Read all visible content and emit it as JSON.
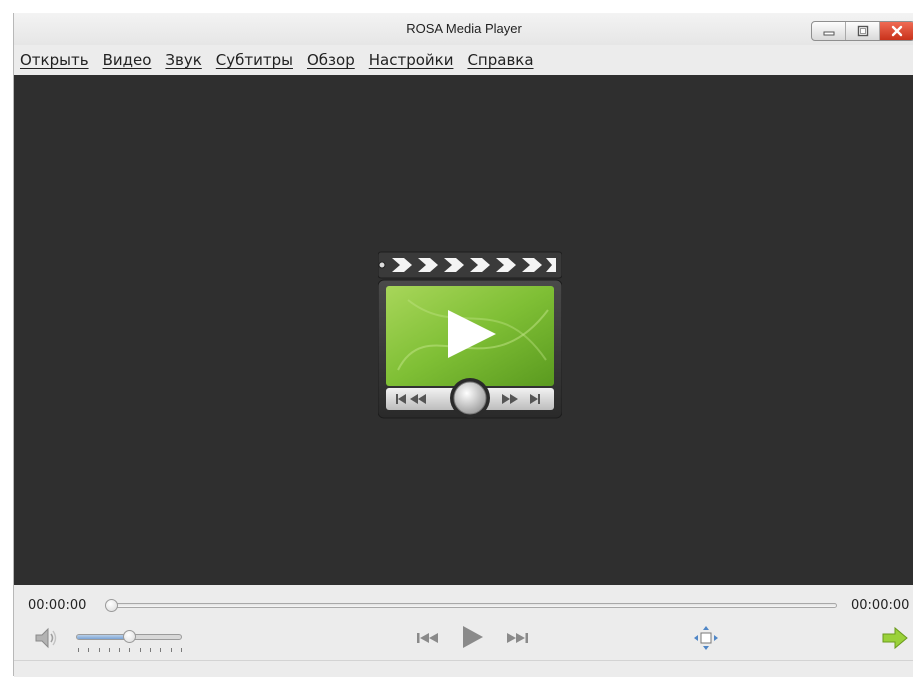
{
  "window": {
    "title": "ROSA Media Player"
  },
  "menu": [
    {
      "label": "Открыть"
    },
    {
      "label": "Видео"
    },
    {
      "label": "Звук"
    },
    {
      "label": "Субтитры"
    },
    {
      "label": "Обзор"
    },
    {
      "label": "Настройки"
    },
    {
      "label": "Справка"
    }
  ],
  "playback": {
    "elapsed": "00:00:00",
    "total": "00:00:00",
    "seek_position": 0,
    "volume_level": 0.5
  },
  "icons": {
    "video_placeholder": "clapperboard-play-icon",
    "mute": "speaker-icon",
    "previous": "skip-previous-icon",
    "play": "play-icon",
    "next": "skip-next-icon",
    "fullscreen": "fullscreen-move-icon",
    "open_playlist": "green-arrow-right-icon"
  },
  "colors": {
    "video_bg": "#2f2f2f",
    "accent_green": "#8cc63f",
    "close_red": "#d9442c"
  }
}
